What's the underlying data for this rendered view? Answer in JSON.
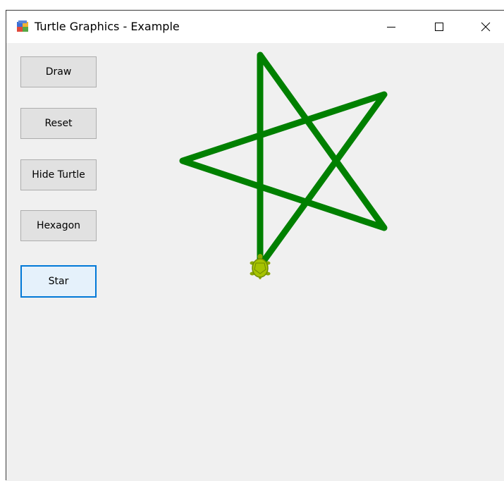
{
  "window": {
    "title": "Turtle Graphics - Example",
    "app_icon": "windows-forms-app-icon",
    "caption_buttons": {
      "minimize_icon": "minimize-icon",
      "maximize_icon": "maximize-icon",
      "close_icon": "close-icon"
    }
  },
  "buttons": {
    "draw": "Draw",
    "reset": "Reset",
    "hide_turtle": "Hide Turtle",
    "hexagon": "Hexagon",
    "star": "Star"
  },
  "canvas": {
    "drawing": "five-pointed-star",
    "pen_color": "#008000",
    "turtle_icon": "turtle-icon",
    "turtle_color": "#a6c300"
  },
  "colors": {
    "form_background": "#f0f0f0",
    "focus_border": "#0078d7"
  }
}
